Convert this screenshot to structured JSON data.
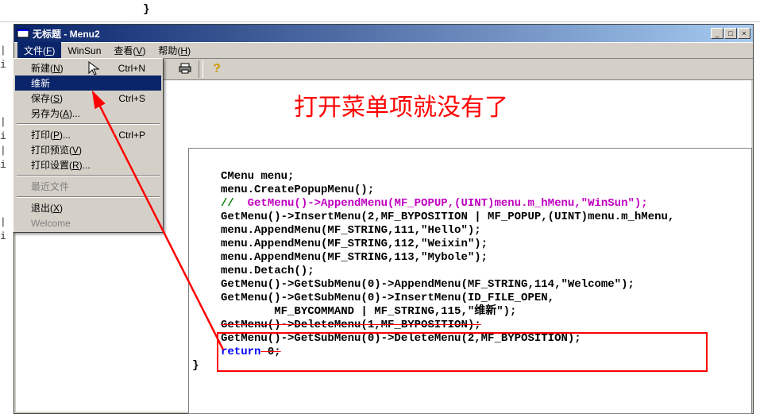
{
  "bg_code_fragment": "}",
  "window": {
    "title": "无标题 - Menu2",
    "btn_min": "_",
    "btn_max": "□",
    "btn_close": "×"
  },
  "menubar": {
    "file": "文件(F)",
    "winsun": "WinSun",
    "view": "查看(V)",
    "help": "帮助(H)"
  },
  "toolbar": {
    "print_icon": "🖨",
    "help_icon": "?"
  },
  "dropdown": {
    "new": {
      "label": "新建(N)",
      "shortcut": "Ctrl+N"
    },
    "weixin": {
      "label": "维新",
      "shortcut": ""
    },
    "save": {
      "label": "保存(S)",
      "shortcut": "Ctrl+S"
    },
    "saveas": {
      "label": "另存为(A)...",
      "shortcut": ""
    },
    "print": {
      "label": "打印(P)...",
      "shortcut": "Ctrl+P"
    },
    "printpreview": {
      "label": "打印预览(V)",
      "shortcut": ""
    },
    "printsetup": {
      "label": "打印设置(R)...",
      "shortcut": ""
    },
    "recent": {
      "label": "最近文件",
      "shortcut": ""
    },
    "exit": {
      "label": "退出(X)",
      "shortcut": ""
    },
    "welcome": {
      "label": "Welcome",
      "shortcut": ""
    }
  },
  "annotation": "打开菜单项就没有了",
  "code": {
    "l1": "CMenu menu;",
    "l2": "menu.CreatePopupMenu();",
    "l3a": "//  ",
    "l3b": "GetMenu()->AppendMenu(MF_POPUP,(UINT)menu.m_hMenu,\"WinSun\");",
    "l4": "GetMenu()->InsertMenu(2,MF_BYPOSITION | MF_POPUP,(UINT)menu.m_hMenu,",
    "l5": "menu.AppendMenu(MF_STRING,111,\"Hello\");",
    "l6": "menu.AppendMenu(MF_STRING,112,\"Weixin\");",
    "l7": "menu.AppendMenu(MF_STRING,113,\"Mybole\");",
    "l8": "menu.Detach();",
    "l9": "GetMenu()->GetSubMenu(0)->AppendMenu(MF_STRING,114,\"Welcome\");",
    "l10": "GetMenu()->GetSubMenu(0)->InsertMenu(ID_FILE_OPEN,",
    "l11": "        MF_BYCOMMAND | MF_STRING,115,\"维新\");",
    "l12": "GetMenu()->DeleteMenu(1,MF_BYPOSITION);",
    "l13": "GetMenu()->GetSubMenu(0)->DeleteMenu(2,MF_BYPOSITION);",
    "l14a": "return",
    "l14b": " 0;",
    "l15": "}"
  },
  "left_gutter": [
    "|",
    "i",
    "",
    "",
    "",
    "|",
    "i",
    "|",
    "i",
    "",
    "",
    "",
    "|",
    "i"
  ],
  "colors": {
    "highlight_bg": "#0a246a",
    "annotation": "#ff0000",
    "comment": "#008000",
    "macro": "#c000c0"
  }
}
